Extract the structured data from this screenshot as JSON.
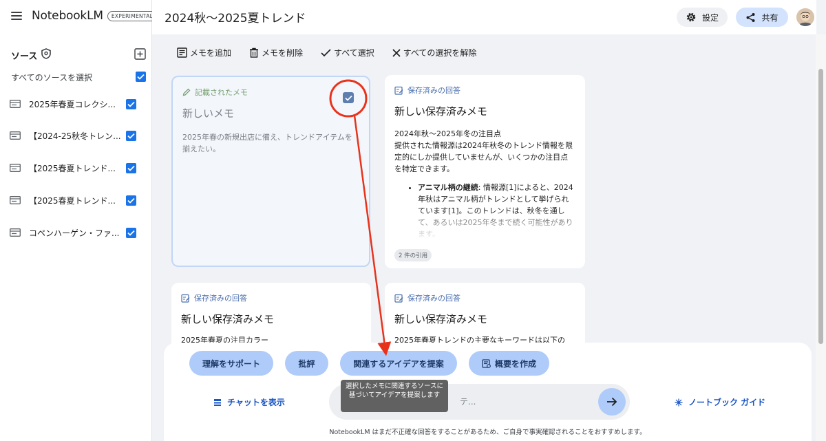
{
  "app": {
    "name": "NotebookLM",
    "badge": "EXPERIMENTAL"
  },
  "sidebar": {
    "title": "ソース",
    "select_all_label": "すべてのソースを選択",
    "select_all_checked": true,
    "sources": [
      {
        "label": "2025年春夏コレクシ...",
        "checked": true
      },
      {
        "label": "【2024-25秋冬トレン...",
        "checked": true
      },
      {
        "label": "【2025春夏トレンド...",
        "checked": true
      },
      {
        "label": "【2025春夏トレンド...",
        "checked": true
      },
      {
        "label": "コペンハーゲン・ファ...",
        "checked": true
      }
    ]
  },
  "header": {
    "title": "2024秋〜2025夏トレンド",
    "settings_label": "設定",
    "share_label": "共有"
  },
  "toolbar": {
    "add_memo": "メモを追加",
    "delete_memo": "メモを削除",
    "select_all": "すべて選択",
    "deselect_all": "すべての選択を解除"
  },
  "cards": {
    "note1": {
      "type": "記載されたメモ",
      "title": "新しいメモ",
      "body": "2025年春の新規出店に備え、トレンドアイテムを揃えたい。",
      "selected": true
    },
    "saved1": {
      "type": "保存済みの回答",
      "title": "新しい保存済みメモ",
      "line1": "2024年秋〜2025年冬の注目点",
      "line2": "提供された情報源は2024年秋冬のトレンド情報を限定的にしか提供していませんが、いくつかの注目点を特定できます。",
      "bullet_title": "アニマル柄の継続",
      "bullet_text": ": 情報源[1]によると、2024年秋はアニマル柄がトレンドとして挙げられています[1]。このトレンドは、秋冬を通して、あるいは2025年冬まで続く可能性があります。",
      "citations": "2 件の引用"
    },
    "saved2": {
      "type": "保存済みの回答",
      "title": "新しい保存済みメモ",
      "body": "2025年春夏の注目カラー"
    },
    "saved3": {
      "type": "保存済みの回答",
      "title": "新しい保存済みメモ",
      "body": "2025年春夏トレンドの主要なキーワードは以下の"
    }
  },
  "bottom": {
    "chips": [
      "理解をサポート",
      "批評",
      "関連するアイデアを提案",
      "概要を作成"
    ],
    "show_chat": "チャットを表示",
    "input_placeholder": "テ...",
    "guide": "ノートブック ガイド",
    "disclaimer": "NotebookLM はまだ不正確な回答をすることがあるため、ご自身で事実確認されることをおすすめします。"
  },
  "tooltip": {
    "text": "選択したメモに関連するソースに基づいてアイデアを提案します"
  },
  "colors": {
    "accent": "#1a73e8",
    "chip": "#aecbfa",
    "annotation": "#e8331c"
  }
}
